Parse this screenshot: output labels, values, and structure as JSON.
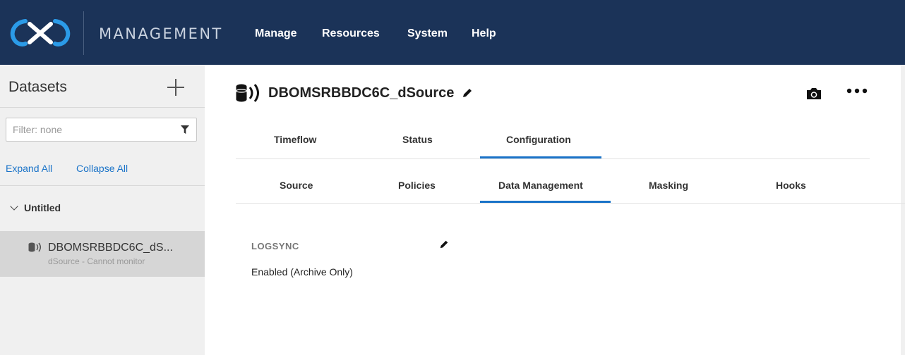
{
  "header": {
    "brand": "MANAGEMENT",
    "logo_icon": "delphix-logo-icon",
    "nav": [
      "Manage",
      "Resources",
      "System",
      "Help"
    ]
  },
  "sidebar": {
    "title": "Datasets",
    "add_icon": "plus-icon",
    "filter_placeholder": "Filter: none",
    "filter_icon": "funnel-icon",
    "expand_all": "Expand All",
    "collapse_all": "Collapse All",
    "group": "Untitled",
    "item": {
      "name": "DBOMSRBBDC6C_dS...",
      "subtitle": "dSource - Cannot monitor",
      "icon": "dsource-icon"
    }
  },
  "main": {
    "title": "DBOMSRBBDC6C_dSource",
    "icon": "dsource-icon",
    "tabs": [
      "Timeflow",
      "Status",
      "Configuration"
    ],
    "active_tab": "Configuration",
    "subtabs": [
      "Source",
      "Policies",
      "Data Management",
      "Masking",
      "Hooks"
    ],
    "active_subtab": "Data Management",
    "field": {
      "label": "LOGSYNC",
      "value": "Enabled (Archive Only)"
    }
  },
  "colors": {
    "header_bg": "#1b3358",
    "accent": "#1a73c8",
    "sidebar_bg": "#f0f0f0",
    "selected_bg": "#d6d6d6"
  }
}
